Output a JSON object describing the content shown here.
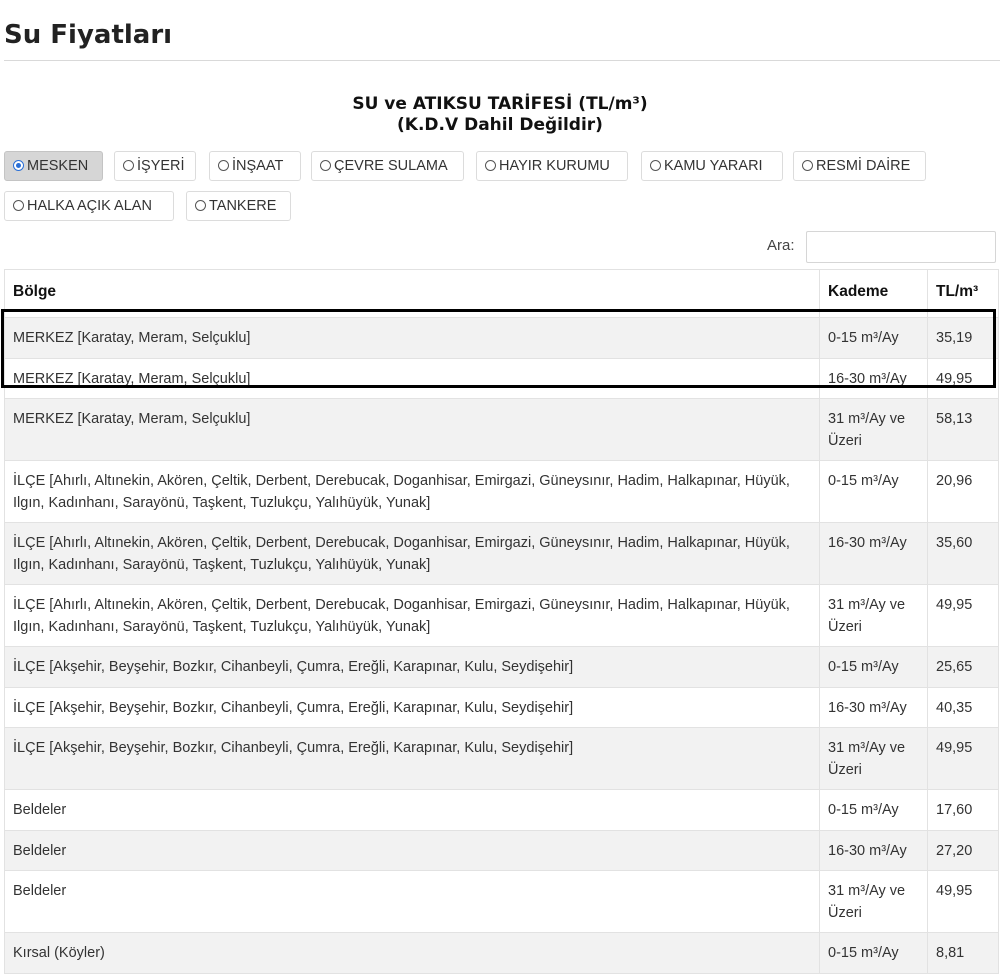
{
  "page_title": "Su Fiyatları",
  "tariff": {
    "line1": "SU ve ATIKSU TARİFESİ (TL/m³)",
    "line2": "(K.D.V Dahil Değildir)"
  },
  "filters": [
    {
      "label": "MESKEN",
      "active": true
    },
    {
      "label": "İŞYERİ",
      "active": false
    },
    {
      "label": "İNŞAAT",
      "active": false
    },
    {
      "label": "ÇEVRE SULAMA",
      "active": false
    },
    {
      "label": "HAYIR KURUMU",
      "active": false
    },
    {
      "label": "KAMU YARARI",
      "active": false
    },
    {
      "label": "RESMİ DAİRE",
      "active": false
    },
    {
      "label": "HALKA AÇIK ALAN",
      "active": false
    },
    {
      "label": "TANKERE",
      "active": false
    }
  ],
  "search": {
    "label": "Ara:",
    "value": "",
    "placeholder": ""
  },
  "table": {
    "headers": {
      "region": "Bölge",
      "tier": "Kademe",
      "price": "TL/m³"
    },
    "rows": [
      {
        "region": "MERKEZ [Karatay, Meram, Selçuklu]",
        "tier": "0-15 m³/Ay",
        "price": "35,19"
      },
      {
        "region": "MERKEZ [Karatay, Meram, Selçuklu]",
        "tier": "16-30 m³/Ay",
        "price": "49,95"
      },
      {
        "region": "MERKEZ [Karatay, Meram, Selçuklu]",
        "tier": "31 m³/Ay ve Üzeri",
        "price": "58,13"
      },
      {
        "region": "İLÇE [Ahırlı, Altınekin, Akören, Çeltik, Derbent, Derebucak, Doganhisar, Emirgazi, Güneysınır, Hadim, Halkapınar, Hüyük, Ilgın, Kadınhanı, Sarayönü, Taşkent, Tuzlukçu, Yalıhüyük, Yunak]",
        "tier": "0-15 m³/Ay",
        "price": "20,96"
      },
      {
        "region": "İLÇE [Ahırlı, Altınekin, Akören, Çeltik, Derbent, Derebucak, Doganhisar, Emirgazi, Güneysınır, Hadim, Halkapınar, Hüyük, Ilgın, Kadınhanı, Sarayönü, Taşkent, Tuzlukçu, Yalıhüyük, Yunak]",
        "tier": "16-30 m³/Ay",
        "price": "35,60"
      },
      {
        "region": "İLÇE [Ahırlı, Altınekin, Akören, Çeltik, Derbent, Derebucak, Doganhisar, Emirgazi, Güneysınır, Hadim, Halkapınar, Hüyük, Ilgın, Kadınhanı, Sarayönü, Taşkent, Tuzlukçu, Yalıhüyük, Yunak]",
        "tier": "31 m³/Ay ve Üzeri",
        "price": "49,95"
      },
      {
        "region": "İLÇE [Akşehir, Beyşehir, Bozkır, Cihanbeyli, Çumra, Ereğli, Karapınar, Kulu, Seydişehir]",
        "tier": "0-15 m³/Ay",
        "price": "25,65"
      },
      {
        "region": "İLÇE [Akşehir, Beyşehir, Bozkır, Cihanbeyli, Çumra, Ereğli, Karapınar, Kulu, Seydişehir]",
        "tier": "16-30 m³/Ay",
        "price": "40,35"
      },
      {
        "region": "İLÇE [Akşehir, Beyşehir, Bozkır, Cihanbeyli, Çumra, Ereğli, Karapınar, Kulu, Seydişehir]",
        "tier": "31 m³/Ay ve Üzeri",
        "price": "49,95"
      },
      {
        "region": "Beldeler",
        "tier": "0-15 m³/Ay",
        "price": "17,60"
      },
      {
        "region": "Beldeler",
        "tier": "16-30 m³/Ay",
        "price": "27,20"
      },
      {
        "region": "Beldeler",
        "tier": "31 m³/Ay ve Üzeri",
        "price": "49,95"
      },
      {
        "region": "Kırsal (Köyler)",
        "tier": "0-15 m³/Ay",
        "price": "8,81"
      }
    ]
  }
}
